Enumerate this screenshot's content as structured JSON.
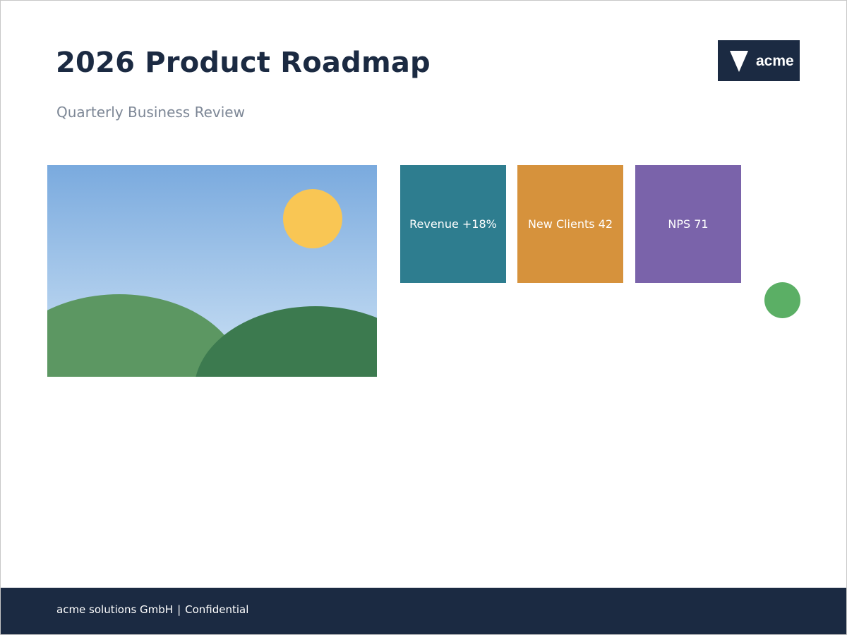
{
  "slide": {
    "title": "2026 Product Roadmap",
    "subtitle": "Quarterly Business Review"
  },
  "logo": {
    "text": "acme",
    "icon": "triangle-down-icon",
    "background": "#1b2a42"
  },
  "image": {
    "icon": "landscape-image-icon",
    "sky_top": "#7aaade",
    "sky_bottom": "#cde2f5",
    "sun_color": "#f9c654",
    "hill_light": "#5c9762",
    "hill_dark": "#3c7a4f"
  },
  "kpis": [
    {
      "label": "Revenue +18%",
      "color": "#2e7d8f"
    },
    {
      "label": "New Clients 42",
      "color": "#d6923c"
    },
    {
      "label": "NPS 71",
      "color": "#7a63aa"
    }
  ],
  "accent_dot": {
    "color": "#5baf65"
  },
  "footer": {
    "company": "acme solutions GmbH",
    "separator": "|",
    "label": "Confidential",
    "background": "#1b2a42"
  }
}
